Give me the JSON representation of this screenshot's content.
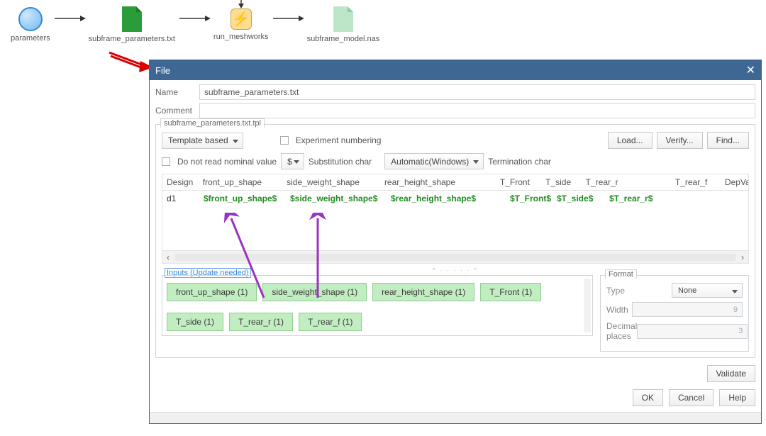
{
  "workflow": {
    "nodes": [
      "parameters",
      "subframe_parameters.txt",
      "run_meshworks",
      "subframe_model.nas"
    ]
  },
  "dialog": {
    "title": "File",
    "name_label": "Name",
    "name_value": "subframe_parameters.txt",
    "comment_label": "Comment",
    "comment_value": "",
    "group_legend": "subframe_parameters.txt.tpl",
    "template_dd": "Template based",
    "exp_numbering": "Experiment numbering",
    "no_nominal": "Do not read nominal value",
    "subchar_dd": "$",
    "subchar_label": "Substitution char",
    "term_dd": "Automatic(Windows)",
    "term_label": "Termination char",
    "load_btn": "Load...",
    "verify_btn": "Verify...",
    "find_btn": "Find...",
    "headers": [
      "Design",
      "front_up_shape",
      "side_weight_shape",
      "rear_height_shape",
      "T_Front",
      "T_side",
      "T_rear_r",
      "T_rear_f",
      "DepVa"
    ],
    "row": {
      "design": "d1",
      "cells": [
        "$front_up_shape$",
        "$side_weight_shape$",
        "$rear_height_shape$",
        "$T_Front$",
        "$T_side$",
        "$T_rear_r$"
      ]
    },
    "inputs_legend": "Inputs (Update needed)",
    "chips": [
      "front_up_shape (1)",
      "side_weight_shape (1)",
      "rear_height_shape (1)",
      "T_Front (1)",
      "T_side (1)",
      "T_rear_r (1)",
      "T_rear_f (1)"
    ],
    "format": {
      "legend": "Format",
      "type_label": "Type",
      "type_value": "None",
      "width_label": "Width",
      "width_value": "9",
      "dec_label": "Decimal places",
      "dec_value": "3"
    },
    "validate_btn": "Validate",
    "ok_btn": "OK",
    "cancel_btn": "Cancel",
    "help_btn": "Help"
  }
}
